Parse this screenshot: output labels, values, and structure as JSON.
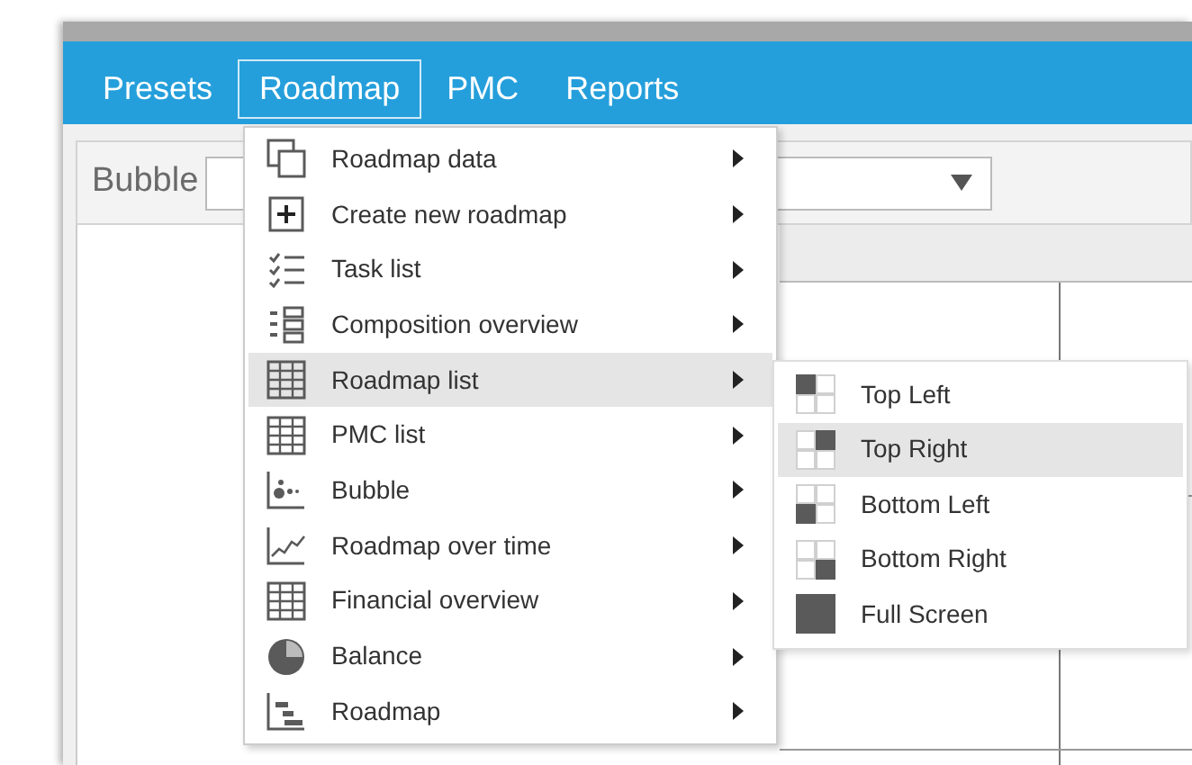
{
  "menu_bar": {
    "items": [
      {
        "label": "Presets",
        "selected": false
      },
      {
        "label": "Roadmap",
        "selected": true
      },
      {
        "label": "PMC",
        "selected": false
      },
      {
        "label": "Reports",
        "selected": false
      }
    ]
  },
  "toolbar": {
    "label": "Bubble"
  },
  "roadmap_menu": {
    "items": [
      {
        "label": "Roadmap data",
        "selected": false,
        "submenu": true
      },
      {
        "label": "Create new roadmap",
        "selected": false,
        "submenu": true
      },
      {
        "label": "Task list",
        "selected": false,
        "submenu": true
      },
      {
        "label": "Composition overview",
        "selected": false,
        "submenu": true
      },
      {
        "label": "Roadmap list",
        "selected": true,
        "submenu": true
      },
      {
        "label": "PMC list",
        "selected": false,
        "submenu": true
      },
      {
        "label": "Bubble",
        "selected": false,
        "submenu": true
      },
      {
        "label": "Roadmap over time",
        "selected": false,
        "submenu": true
      },
      {
        "label": "Financial overview",
        "selected": false,
        "submenu": true
      },
      {
        "label": "Balance",
        "selected": false,
        "submenu": true
      },
      {
        "label": "Roadmap",
        "selected": false,
        "submenu": true
      }
    ]
  },
  "position_menu": {
    "items": [
      {
        "label": "Top Left",
        "selected": false
      },
      {
        "label": "Top Right",
        "selected": true
      },
      {
        "label": "Bottom Left",
        "selected": false
      },
      {
        "label": "Bottom Right",
        "selected": false
      },
      {
        "label": "Full Screen",
        "selected": false
      }
    ]
  }
}
